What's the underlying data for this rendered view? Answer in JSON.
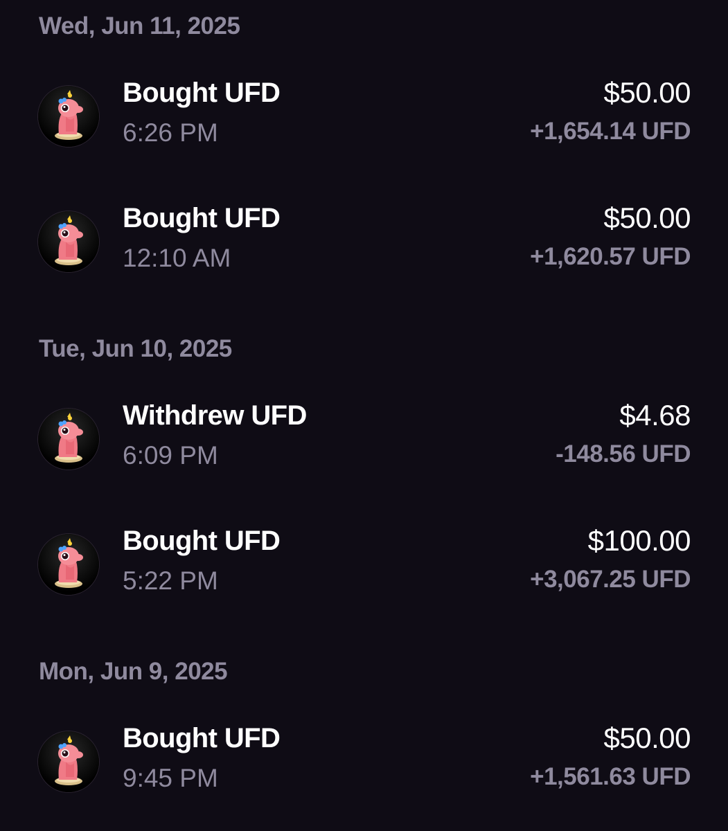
{
  "groups": [
    {
      "date": "Wed, Jun 11, 2025",
      "transactions": [
        {
          "title": "Bought UFD",
          "time": "6:26 PM",
          "amount": "$50.00",
          "delta": "+1,654.14 UFD",
          "icon": "ufd-token-icon"
        },
        {
          "title": "Bought UFD",
          "time": "12:10 AM",
          "amount": "$50.00",
          "delta": "+1,620.57 UFD",
          "icon": "ufd-token-icon"
        }
      ]
    },
    {
      "date": "Tue, Jun 10, 2025",
      "transactions": [
        {
          "title": "Withdrew UFD",
          "time": "6:09 PM",
          "amount": "$4.68",
          "delta": "-148.56 UFD",
          "icon": "ufd-token-icon"
        },
        {
          "title": "Bought UFD",
          "time": "5:22 PM",
          "amount": "$100.00",
          "delta": "+3,067.25 UFD",
          "icon": "ufd-token-icon"
        }
      ]
    },
    {
      "date": "Mon, Jun 9, 2025",
      "transactions": [
        {
          "title": "Bought UFD",
          "time": "9:45 PM",
          "amount": "$50.00",
          "delta": "+1,561.63 UFD",
          "icon": "ufd-token-icon"
        }
      ]
    }
  ],
  "colors": {
    "background": "#0f0c15",
    "primary_text": "#ffffff",
    "secondary_text": "#8f8a9e"
  }
}
